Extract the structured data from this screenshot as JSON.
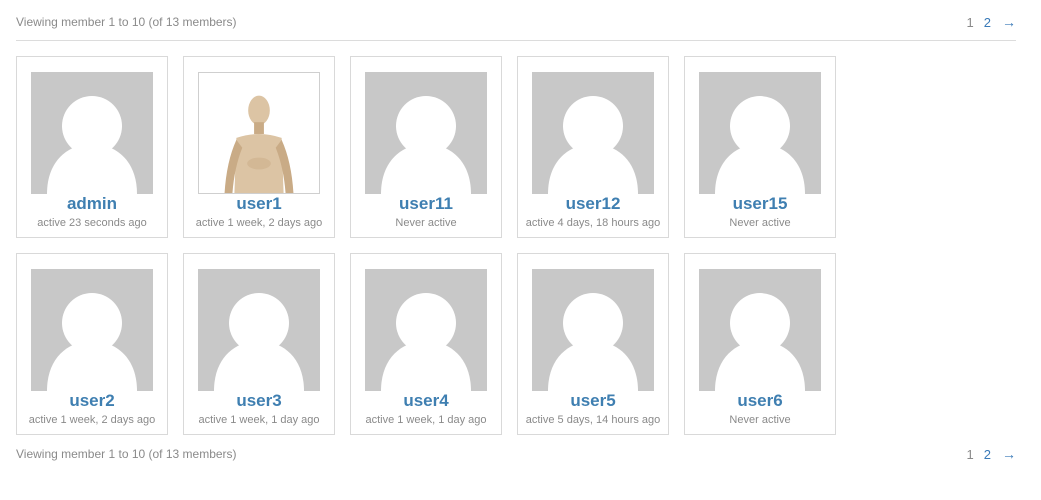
{
  "pagination": {
    "summary": "Viewing member 1 to 10 (of 13 members)",
    "current_page": "1",
    "next_page": "2",
    "next_arrow": "→"
  },
  "members": [
    {
      "name": "admin",
      "status": "active 23 seconds ago",
      "avatar": "default-avatar-icon"
    },
    {
      "name": "user1",
      "status": "active 1 week, 2 days ago",
      "avatar": "wooden-mannequin-photo"
    },
    {
      "name": "user11",
      "status": "Never active",
      "avatar": "default-avatar-icon"
    },
    {
      "name": "user12",
      "status": "active 4 days, 18 hours ago",
      "avatar": "default-avatar-icon"
    },
    {
      "name": "user15",
      "status": "Never active",
      "avatar": "default-avatar-icon"
    },
    {
      "name": "user2",
      "status": "active 1 week, 2 days ago",
      "avatar": "default-avatar-icon"
    },
    {
      "name": "user3",
      "status": "active 1 week, 1 day ago",
      "avatar": "default-avatar-icon"
    },
    {
      "name": "user4",
      "status": "active 1 week, 1 day ago",
      "avatar": "default-avatar-icon"
    },
    {
      "name": "user5",
      "status": "active 5 days, 14 hours ago",
      "avatar": "default-avatar-icon"
    },
    {
      "name": "user6",
      "status": "Never active",
      "avatar": "default-avatar-icon"
    }
  ],
  "colors": {
    "link": "#3f7fb1",
    "muted_text": "#8a8a8a",
    "avatar_bg": "#c8c8c8",
    "border": "#d9d9d9"
  }
}
